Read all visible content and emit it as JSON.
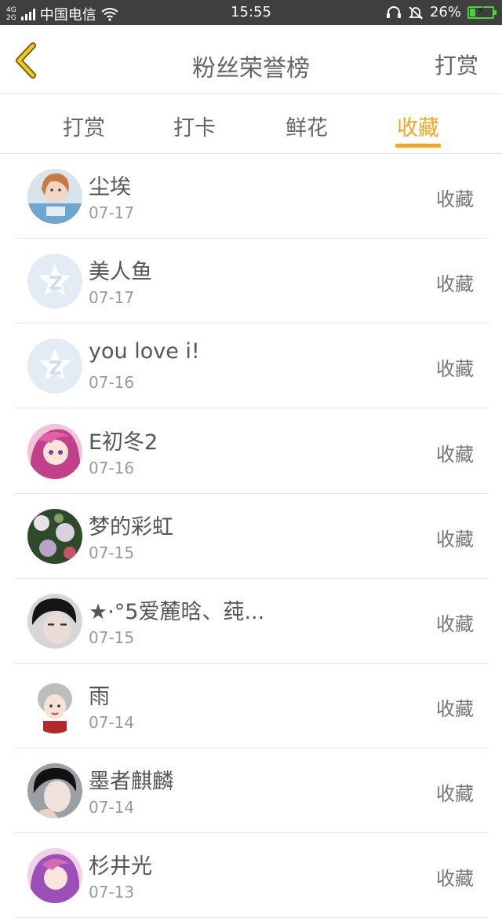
{
  "status_bar": {
    "network_type_top": "4G",
    "network_type_bottom": "2G",
    "carrier": "中国电信",
    "time": "15:55",
    "battery": "26%",
    "battery_level": 0.26
  },
  "nav": {
    "title": "粉丝荣誉榜",
    "action": "打赏"
  },
  "tabs": [
    {
      "label": "打赏",
      "active": false
    },
    {
      "label": "打卡",
      "active": false
    },
    {
      "label": "鲜花",
      "active": false
    },
    {
      "label": "收藏",
      "active": true
    }
  ],
  "list": [
    {
      "name": "尘埃",
      "date": "07-17",
      "action": "收藏",
      "avatar": "photo-girl"
    },
    {
      "name": "美人鱼",
      "date": "07-17",
      "action": "收藏",
      "avatar": "default-z"
    },
    {
      "name": "you love i!",
      "date": "07-16",
      "action": "收藏",
      "avatar": "default-z"
    },
    {
      "name": "E初冬2",
      "date": "07-16",
      "action": "收藏",
      "avatar": "anime-pink"
    },
    {
      "name": "梦的彩虹",
      "date": "07-15",
      "action": "收藏",
      "avatar": "flowers"
    },
    {
      "name": "★·°5爱麓晗、莼...",
      "date": "07-15",
      "action": "收藏",
      "avatar": "photo-boy-dark"
    },
    {
      "name": "雨",
      "date": "07-14",
      "action": "收藏",
      "avatar": "illustration-girl"
    },
    {
      "name": "墨者麒麟",
      "date": "07-14",
      "action": "收藏",
      "avatar": "photo-boy"
    },
    {
      "name": "杉井光",
      "date": "07-13",
      "action": "收藏",
      "avatar": "anime-purple"
    }
  ],
  "colors": {
    "accent": "#f5a623",
    "status_bar": "#3f3f3f",
    "text": "#666666",
    "divider": "#e6e6e6",
    "back_icon": "#f3c623"
  }
}
